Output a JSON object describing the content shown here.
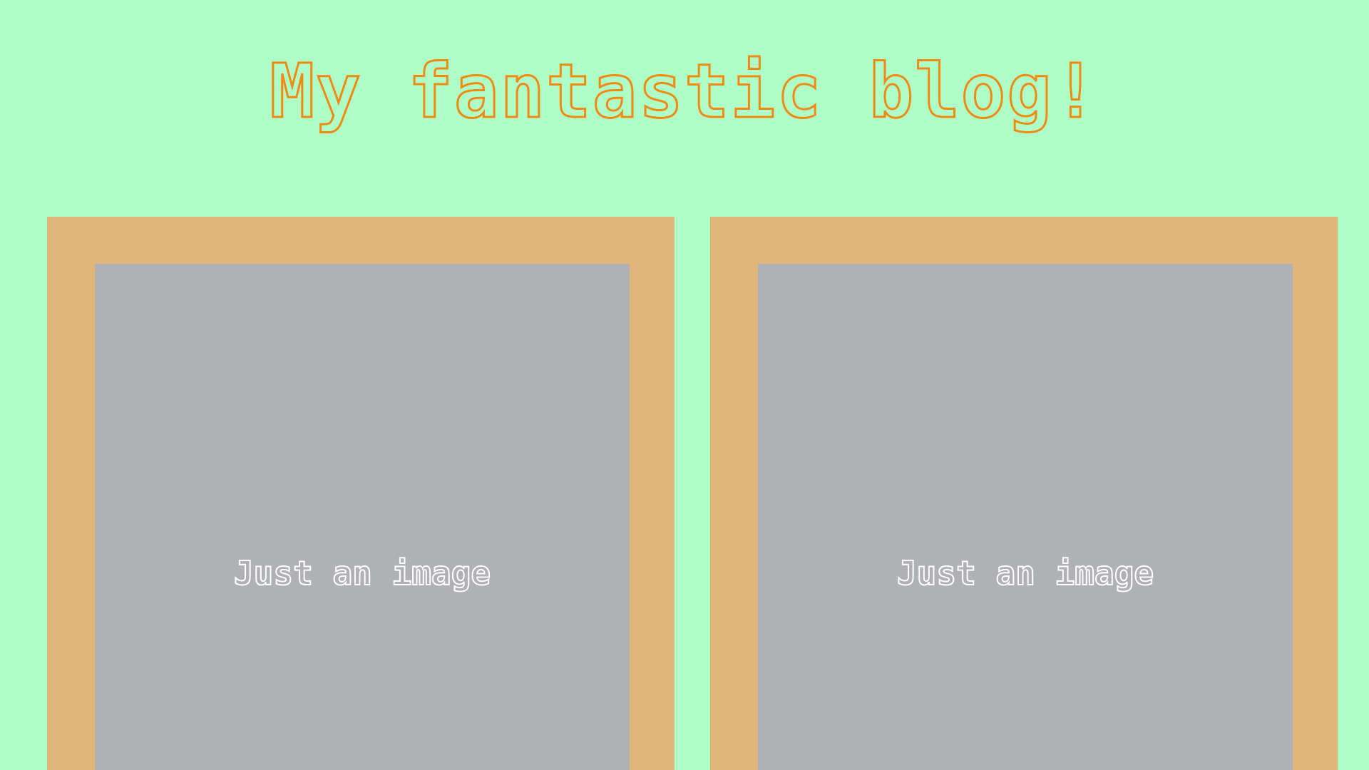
{
  "header": {
    "title": "My fantastic blog!"
  },
  "posts": [
    {
      "image_caption": "Just an image"
    },
    {
      "image_caption": "Just an image"
    }
  ],
  "colors": {
    "background": "#b0fec7",
    "title_outline": "#f08a12",
    "card_frame": "#e1b67a",
    "image_placeholder": "#afb1b4",
    "caption_outline": "#ffffff"
  }
}
